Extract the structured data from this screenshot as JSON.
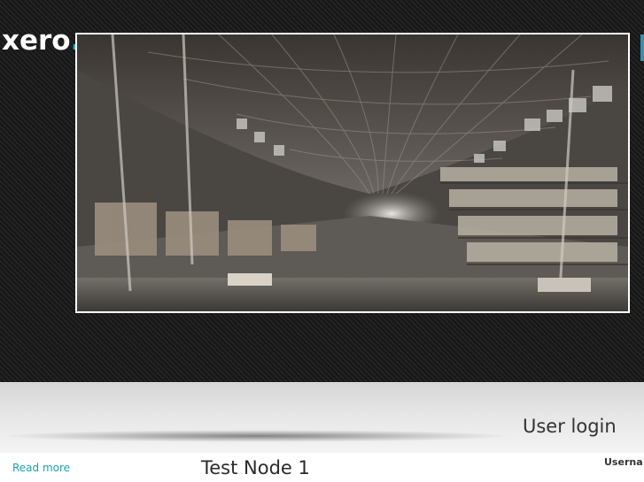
{
  "site": {
    "logo_text": "xero",
    "logo_dot": "."
  },
  "slideshow": {
    "image_subject": "warehouse-interior"
  },
  "sidebar": {
    "login_title": "User login",
    "username_label": "Userna"
  },
  "main": {
    "read_more": "Read more",
    "node_title": "Test Node 1"
  },
  "colors": {
    "header_bg": "#1c1c1c",
    "accent": "#1ab6c6",
    "link": "#1a9fb0",
    "text": "#333333"
  }
}
